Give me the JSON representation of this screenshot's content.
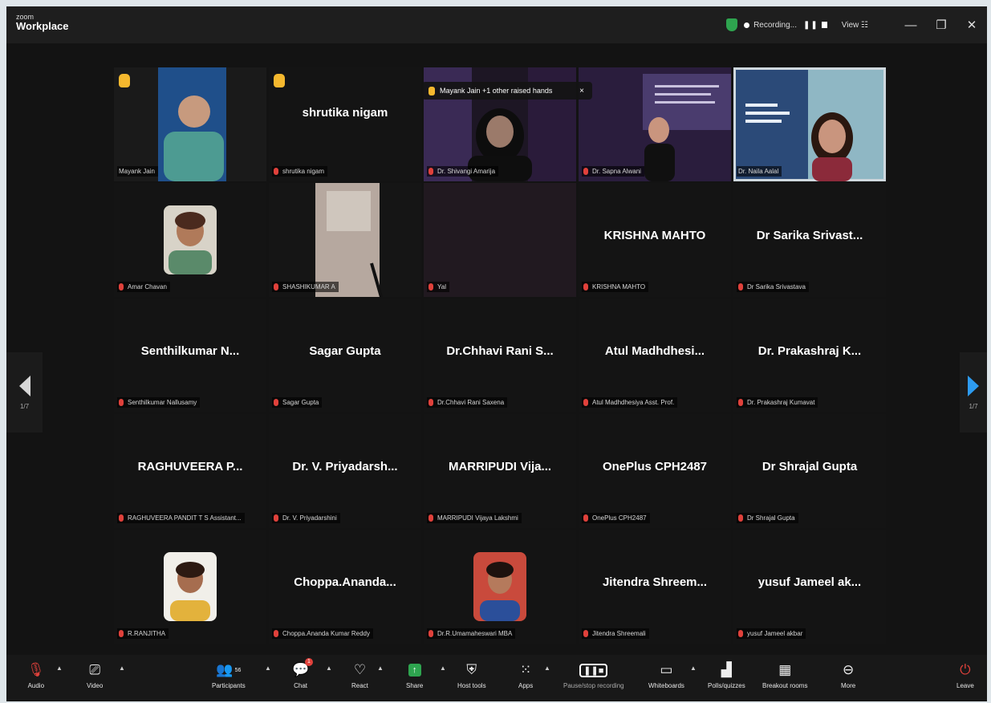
{
  "app": {
    "brand_small": "zoom",
    "brand_big": "Workplace"
  },
  "titlebar": {
    "recording": "Recording...",
    "view": "View"
  },
  "raised_hands": {
    "text": "Mayank Jain +1 other raised hands",
    "close": "×"
  },
  "pager": {
    "left": "1/7",
    "right": "1/7"
  },
  "tiles": [
    {
      "big": "",
      "plate": "Mayank Jain"
    },
    {
      "big": "shrutika nigam",
      "plate": "shrutika nigam"
    },
    {
      "big": "",
      "plate": "Dr. Shivangi Amarija"
    },
    {
      "big": "",
      "plate": "Dr. Sapna Alwani"
    },
    {
      "big": "",
      "plate": "Dr. Naila Aalal"
    },
    {
      "big": "",
      "plate": "Amar Chavan"
    },
    {
      "big": "",
      "plate": "SHASHIKUMAR A"
    },
    {
      "big": "",
      "plate": "Yal"
    },
    {
      "big": "KRISHNA MAHTO",
      "plate": "KRISHNA MAHTO"
    },
    {
      "big": "Dr Sarika Srivast...",
      "plate": "Dr Sarika Srivastava"
    },
    {
      "big": "Senthilkumar N...",
      "plate": "Senthilkumar Nallusamy"
    },
    {
      "big": "Sagar Gupta",
      "plate": "Sagar Gupta"
    },
    {
      "big": "Dr.Chhavi Rani S...",
      "plate": "Dr.Chhavi Rani Saxena"
    },
    {
      "big": "Atul Madhdhesi...",
      "plate": "Atul Madhdhesiya Asst. Prof."
    },
    {
      "big": "Dr. Prakashraj K...",
      "plate": "Dr. Prakashraj Kumavat"
    },
    {
      "big": "RAGHUVEERA P...",
      "plate": "RAGHUVEERA PANDIT T S Assistant..."
    },
    {
      "big": "Dr. V. Priyadarsh...",
      "plate": "Dr. V. Priyadarshini"
    },
    {
      "big": "MARRIPUDI Vija...",
      "plate": "MARRIPUDI Vijaya Lakshmi"
    },
    {
      "big": "OnePlus CPH2487",
      "plate": "OnePlus CPH2487"
    },
    {
      "big": "Dr Shrajal Gupta",
      "plate": "Dr Shrajal Gupta"
    },
    {
      "big": "",
      "plate": "R.RANJITHA"
    },
    {
      "big": "Choppa.Ananda...",
      "plate": "Choppa.Ananda Kumar Reddy"
    },
    {
      "big": "",
      "plate": "Dr.R.Umamaheswari MBA"
    },
    {
      "big": "Jitendra Shreem...",
      "plate": "Jitendra Shreemali"
    },
    {
      "big": "yusuf Jameel ak...",
      "plate": "yusuf Jameel akbar"
    }
  ],
  "toolbar": {
    "audio": "Audio",
    "video": "Video",
    "participants": "Participants",
    "participants_count": "56",
    "chat": "Chat",
    "chat_badge": "1",
    "react": "React",
    "share": "Share",
    "host_tools": "Host tools",
    "apps": "Apps",
    "pause_stop": "Pause/stop recording",
    "whiteboards": "Whiteboards",
    "polls": "Polls/quizzes",
    "breakout": "Breakout rooms",
    "more": "More",
    "leave": "Leave"
  },
  "colors": {
    "active_speaker": "#3fd27a",
    "mic_off": "#e0413b",
    "raised_hand": "#f5b82e",
    "share": "#2ea44f"
  }
}
